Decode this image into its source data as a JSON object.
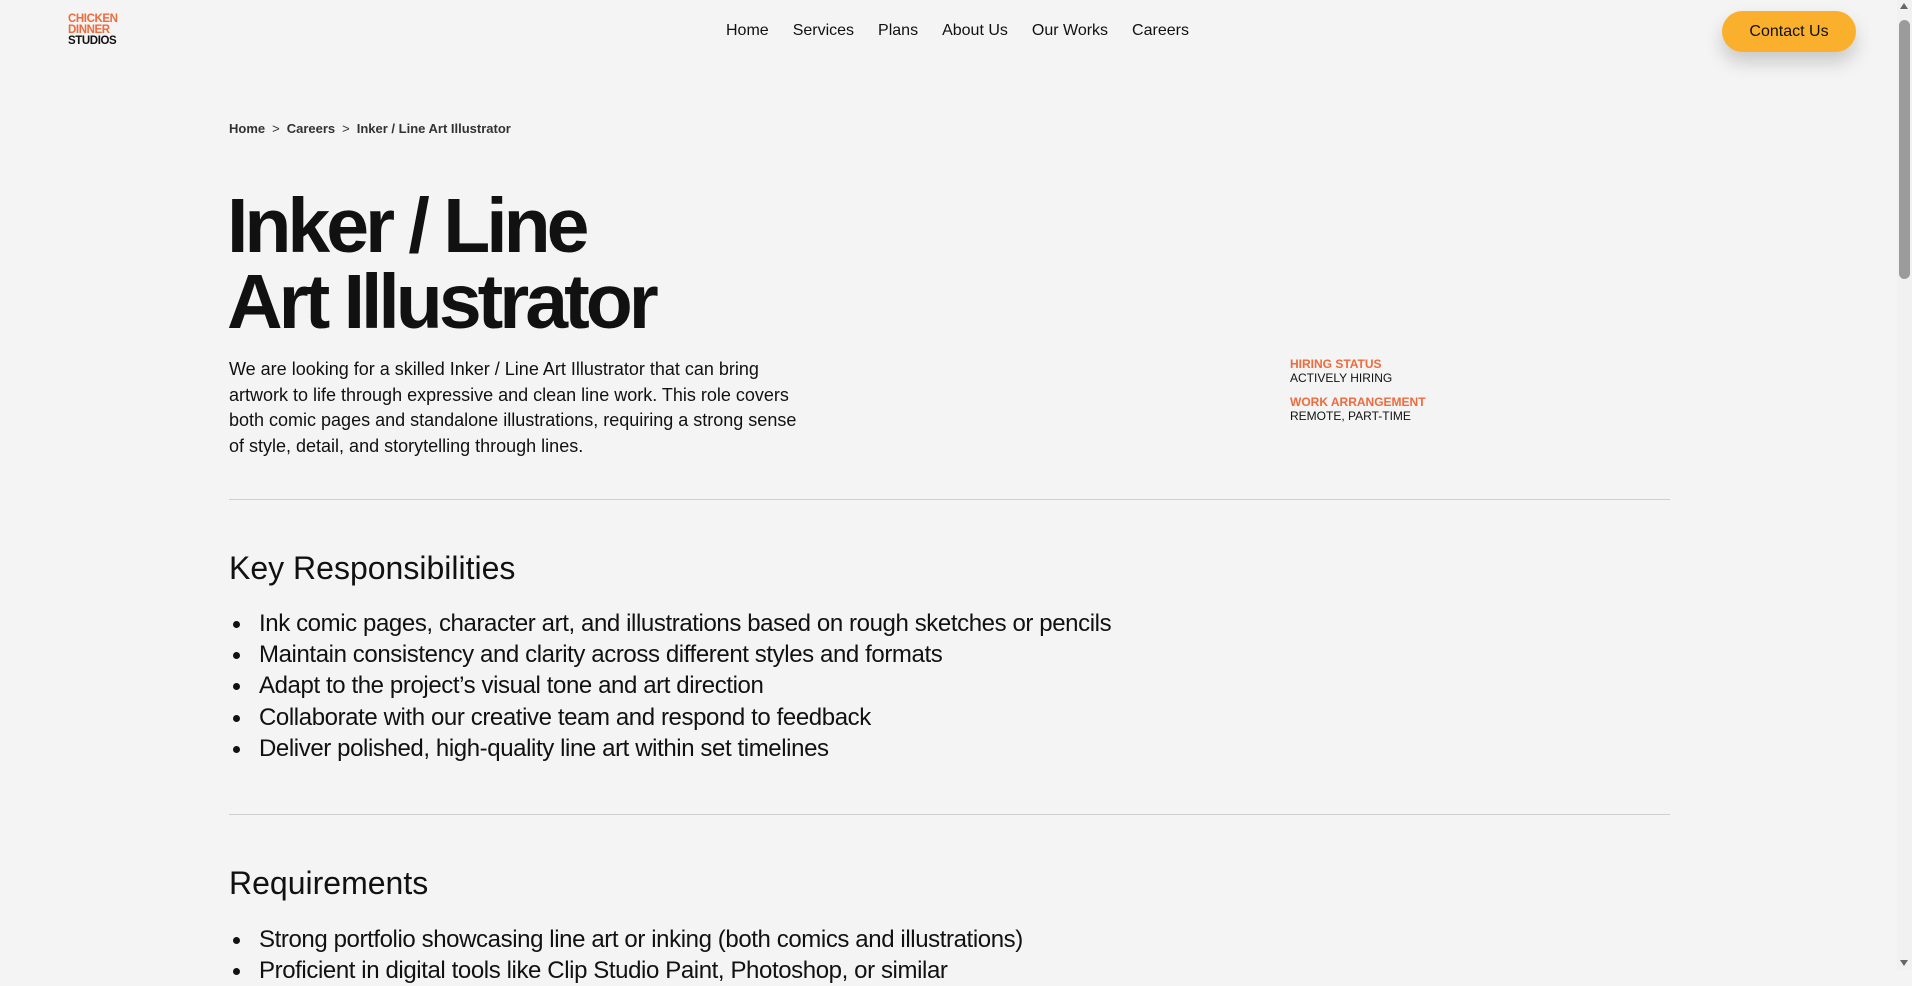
{
  "logo": {
    "line1": "CHICKEN",
    "line2": "DINNER",
    "line3": "STUDIOS"
  },
  "nav": {
    "items": [
      {
        "label": "Home"
      },
      {
        "label": "Services"
      },
      {
        "label": "Plans"
      },
      {
        "label": "About Us"
      },
      {
        "label": "Our Works"
      },
      {
        "label": "Careers"
      }
    ]
  },
  "header": {
    "contact_label": "Contact Us"
  },
  "breadcrumb": {
    "items": [
      "Home",
      "Careers",
      "Inker / Line Art Illustrator"
    ],
    "separator": ">"
  },
  "job": {
    "title_line1": "Inker / Line",
    "title_line2": "Art Illustrator",
    "intro": "We are looking for a skilled Inker / Line Art Illustrator that can bring artwork to life through expressive and clean line work. This role covers both comic pages and standalone illustrations, requiring a strong sense of style, detail, and storytelling through lines.",
    "hiring_status_label": "HIRING STATUS",
    "hiring_status_value": "ACTIVELY HIRING",
    "arrangement_label": "WORK ARRANGEMENT",
    "arrangement_value": "REMOTE, PART-TIME"
  },
  "responsibilities": {
    "heading": "Key Responsibilities",
    "items": [
      "Ink comic pages, character art, and illustrations based on rough sketches or pencils",
      "Maintain consistency and clarity across different styles and formats",
      "Adapt to the project’s visual tone and art direction",
      "Collaborate with our creative team and respond to feedback",
      "Deliver polished, high-quality line art within set timelines"
    ]
  },
  "requirements": {
    "heading": "Requirements",
    "items": [
      "Strong portfolio showcasing line art or inking (both comics and illustrations)",
      "Proficient in digital tools like Clip Studio Paint, Photoshop, or similar"
    ]
  },
  "colors": {
    "accent": "#ef6a3c",
    "button": "#fbb02d",
    "background": "#f4f4f4"
  }
}
